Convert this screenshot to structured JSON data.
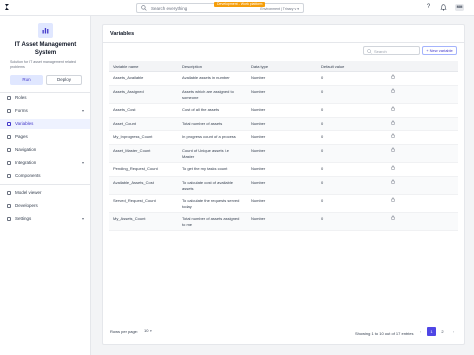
{
  "topbar": {
    "search_placeholder": "Search everything",
    "env_badge": "Development - Work platform",
    "env_selector": "Environment | Trinary v ▾",
    "help_icon": "?",
    "bell_icon": "bell",
    "avatar_initials": "MM"
  },
  "sidebar": {
    "app_title": "IT Asset Management System",
    "app_description": "Solution for IT asset management related problems",
    "run_label": "Run",
    "deploy_label": "Deploy",
    "items": [
      {
        "label": "Roles",
        "icon": "roles-icon",
        "chevron": ""
      },
      {
        "label": "Forms",
        "icon": "forms-icon",
        "chevron": "▾"
      },
      {
        "label": "Variables",
        "icon": "variables-icon",
        "chevron": "",
        "active": true
      },
      {
        "label": "Pages",
        "icon": "pages-icon",
        "chevron": ""
      },
      {
        "label": "Navigation",
        "icon": "navigation-icon",
        "chevron": ""
      },
      {
        "label": "Integration",
        "icon": "integration-icon",
        "chevron": "▾"
      },
      {
        "label": "Components",
        "icon": "components-icon",
        "chevron": ""
      },
      {
        "label": "Model viewer",
        "icon": "model-viewer-icon",
        "chevron": ""
      },
      {
        "label": "Developers",
        "icon": "developers-icon",
        "chevron": ""
      },
      {
        "label": "Settings",
        "icon": "settings-icon",
        "chevron": "▾"
      }
    ]
  },
  "main": {
    "title": "Variables",
    "search_placeholder": "Search",
    "new_variable_label": "+ New variable",
    "columns": [
      "Variable name",
      "Description",
      "Data type",
      "Default value"
    ],
    "rows": [
      {
        "name": "Assets_Available",
        "description": [
          "Available assets in number"
        ],
        "type": "Number",
        "default": "0"
      },
      {
        "name": "Assets_Assigned",
        "description": [
          "Assets which are assigned to",
          "someone"
        ],
        "type": "Number",
        "default": "0"
      },
      {
        "name": "Assets_Cost",
        "description": [
          "Cost of all the assets"
        ],
        "type": "Number",
        "default": "0"
      },
      {
        "name": "Asset_Count",
        "description": [
          "Total number of assets"
        ],
        "type": "Number",
        "default": "0"
      },
      {
        "name": "My_Inprogress_Count",
        "description": [
          "In progress count of a process"
        ],
        "type": "Number",
        "default": "0"
      },
      {
        "name": "Asset_Master_Count",
        "description": [
          "Count of Unique assets i.e",
          "Master"
        ],
        "type": "Number",
        "default": "0"
      },
      {
        "name": "Pending_Request_Count",
        "description": [
          "To get the my tasks count"
        ],
        "type": "Number",
        "default": "0"
      },
      {
        "name": "Available_Assets_Cost",
        "description": [
          "To calculate cost of available",
          "assets"
        ],
        "type": "Number",
        "default": "0"
      },
      {
        "name": "Served_Request_Count",
        "description": [
          "To calculate the requests served",
          "today"
        ],
        "type": "Number",
        "default": "0"
      },
      {
        "name": "My_Assets_Count",
        "description": [
          "Total number of assets assigned",
          "to me"
        ],
        "type": "Number",
        "default": "0"
      }
    ],
    "rows_per_page_label": "Rows per page:",
    "rows_per_page_value": "10",
    "showing_text": "Showing 1 to 10 out of 17 entries",
    "pages": [
      "1",
      "2"
    ],
    "current_page": "1"
  },
  "colors": {
    "accent": "#4f46e5",
    "active_bg": "#eef2ff",
    "env_badge": "#f59e0b"
  }
}
